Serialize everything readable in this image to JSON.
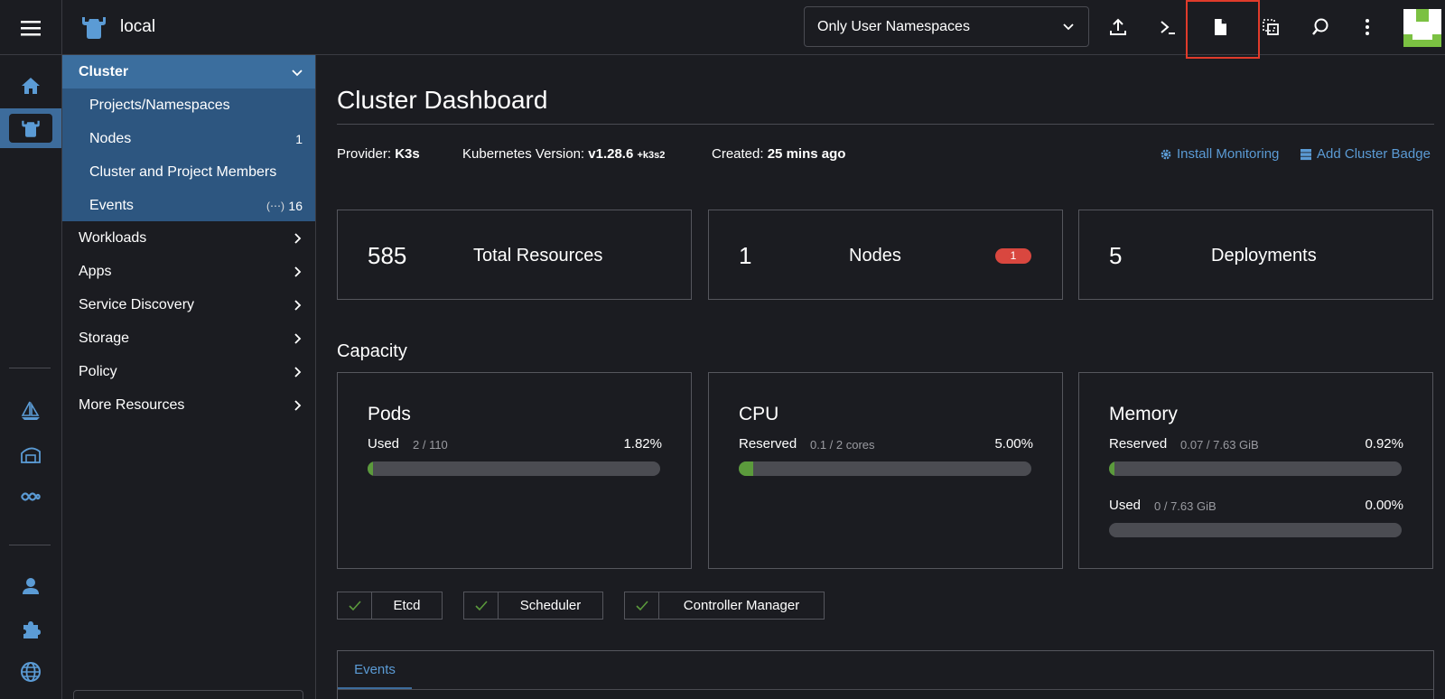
{
  "header": {
    "cluster_name": "local",
    "namespace_filter": "Only User Namespaces"
  },
  "sidebar": {
    "cluster_group": {
      "label": "Cluster",
      "items": [
        {
          "label": "Projects/Namespaces",
          "count": ""
        },
        {
          "label": "Nodes",
          "count": "1"
        },
        {
          "label": "Cluster and Project Members",
          "count": ""
        },
        {
          "label": "Events",
          "count": "16",
          "icon": "(⋯)"
        }
      ]
    },
    "groups": [
      {
        "label": "Workloads"
      },
      {
        "label": "Apps"
      },
      {
        "label": "Service Discovery"
      },
      {
        "label": "Storage"
      },
      {
        "label": "Policy"
      },
      {
        "label": "More Resources"
      }
    ]
  },
  "main": {
    "title": "Cluster Dashboard",
    "meta": {
      "provider_label": "Provider:",
      "provider_value": "K3s",
      "version_label": "Kubernetes Version:",
      "version_value": "v1.28.6",
      "version_suffix": "+k3s2",
      "created_label": "Created:",
      "created_value": "25 mins ago",
      "install_monitoring": "Install Monitoring",
      "add_badge": "Add Cluster Badge"
    },
    "stats": [
      {
        "value": "585",
        "label": "Total Resources"
      },
      {
        "value": "1",
        "label": "Nodes",
        "badge": "1"
      },
      {
        "value": "5",
        "label": "Deployments"
      }
    ],
    "capacity": {
      "title": "Capacity",
      "pods": {
        "title": "Pods",
        "label": "Used",
        "sub": "2 / 110",
        "pct": "1.82%",
        "fraction": 0.0182
      },
      "cpu": {
        "title": "CPU",
        "label": "Reserved",
        "sub": "0.1 / 2 cores",
        "pct": "5.00%",
        "fraction": 0.05
      },
      "memory": {
        "title": "Memory",
        "reserved": {
          "label": "Reserved",
          "sub": "0.07 / 7.63 GiB",
          "pct": "0.92%",
          "fraction": 0.0092
        },
        "used": {
          "label": "Used",
          "sub": "0 / 7.63 GiB",
          "pct": "0.00%",
          "fraction": 0
        }
      }
    },
    "components": [
      {
        "name": "Etcd"
      },
      {
        "name": "Scheduler"
      },
      {
        "name": "Controller Manager"
      }
    ],
    "events_tab": "Events"
  },
  "colors": {
    "accent": "#5b9bd5",
    "active_nav": "#3b6e9e",
    "success": "#5b9a3c",
    "error": "#d9473f"
  }
}
